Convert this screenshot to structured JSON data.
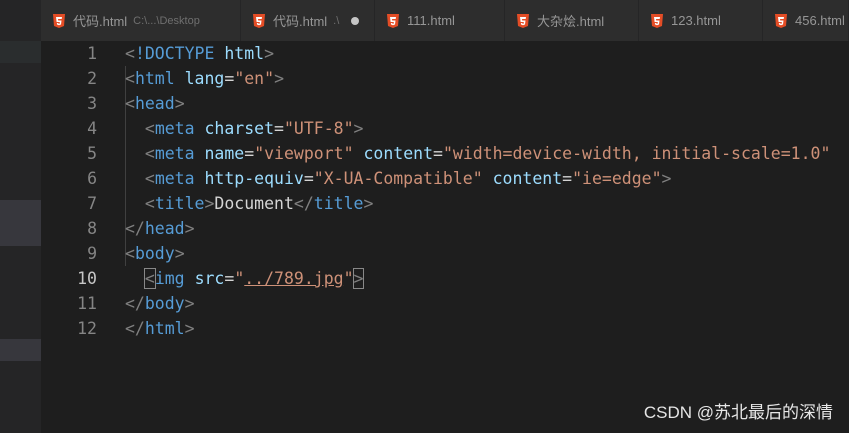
{
  "tabs": [
    {
      "name": "代码.html",
      "desc": "C:\\...\\Desktop",
      "dirty": false
    },
    {
      "name": "代码.html",
      "desc": ".\\",
      "dirty": true
    },
    {
      "name": "111.html",
      "desc": "",
      "dirty": false
    },
    {
      "name": "大杂烩.html",
      "desc": "",
      "dirty": false
    },
    {
      "name": "123.html",
      "desc": "",
      "dirty": false
    },
    {
      "name": "456.html",
      "desc": "",
      "dirty": false
    }
  ],
  "editor": {
    "active_line": 10,
    "line_numbers": [
      "1",
      "2",
      "3",
      "4",
      "5",
      "6",
      "7",
      "8",
      "9",
      "10",
      "11",
      "12"
    ],
    "lines": [
      {
        "tokens": [
          {
            "c": "br",
            "t": "<"
          },
          {
            "c": "tg",
            "t": "!DOCTYPE"
          },
          {
            "c": "tx",
            "t": " "
          },
          {
            "c": "at",
            "t": "html"
          },
          {
            "c": "br",
            "t": ">"
          }
        ]
      },
      {
        "tokens": [
          {
            "c": "br",
            "t": "<"
          },
          {
            "c": "tg",
            "t": "html"
          },
          {
            "c": "tx",
            "t": " "
          },
          {
            "c": "at",
            "t": "lang"
          },
          {
            "c": "tx",
            "t": "="
          },
          {
            "c": "st",
            "t": "\"en\""
          },
          {
            "c": "br",
            "t": ">"
          }
        ]
      },
      {
        "tokens": [
          {
            "c": "br",
            "t": "<"
          },
          {
            "c": "tg",
            "t": "head"
          },
          {
            "c": "br",
            "t": ">"
          }
        ]
      },
      {
        "tokens": [
          {
            "c": "tx",
            "t": "  "
          },
          {
            "c": "br",
            "t": "<"
          },
          {
            "c": "tg",
            "t": "meta"
          },
          {
            "c": "tx",
            "t": " "
          },
          {
            "c": "at",
            "t": "charset"
          },
          {
            "c": "tx",
            "t": "="
          },
          {
            "c": "st",
            "t": "\"UTF-8\""
          },
          {
            "c": "br",
            "t": ">"
          }
        ]
      },
      {
        "tokens": [
          {
            "c": "tx",
            "t": "  "
          },
          {
            "c": "br",
            "t": "<"
          },
          {
            "c": "tg",
            "t": "meta"
          },
          {
            "c": "tx",
            "t": " "
          },
          {
            "c": "at",
            "t": "name"
          },
          {
            "c": "tx",
            "t": "="
          },
          {
            "c": "st",
            "t": "\"viewport\""
          },
          {
            "c": "tx",
            "t": " "
          },
          {
            "c": "at",
            "t": "content"
          },
          {
            "c": "tx",
            "t": "="
          },
          {
            "c": "st",
            "t": "\"width=device-width, initial-scale=1.0\""
          }
        ]
      },
      {
        "tokens": [
          {
            "c": "tx",
            "t": "  "
          },
          {
            "c": "br",
            "t": "<"
          },
          {
            "c": "tg",
            "t": "meta"
          },
          {
            "c": "tx",
            "t": " "
          },
          {
            "c": "at",
            "t": "http-equiv"
          },
          {
            "c": "tx",
            "t": "="
          },
          {
            "c": "st",
            "t": "\"X-UA-Compatible\""
          },
          {
            "c": "tx",
            "t": " "
          },
          {
            "c": "at",
            "t": "content"
          },
          {
            "c": "tx",
            "t": "="
          },
          {
            "c": "st",
            "t": "\"ie=edge\""
          },
          {
            "c": "br",
            "t": ">"
          }
        ]
      },
      {
        "tokens": [
          {
            "c": "tx",
            "t": "  "
          },
          {
            "c": "br",
            "t": "<"
          },
          {
            "c": "tg",
            "t": "title"
          },
          {
            "c": "br",
            "t": ">"
          },
          {
            "c": "tx",
            "t": "Document"
          },
          {
            "c": "br",
            "t": "</"
          },
          {
            "c": "tg",
            "t": "title"
          },
          {
            "c": "br",
            "t": ">"
          }
        ]
      },
      {
        "tokens": [
          {
            "c": "br",
            "t": "</"
          },
          {
            "c": "tg",
            "t": "head"
          },
          {
            "c": "br",
            "t": ">"
          }
        ]
      },
      {
        "tokens": [
          {
            "c": "br",
            "t": "<"
          },
          {
            "c": "tg",
            "t": "body"
          },
          {
            "c": "br",
            "t": ">"
          }
        ]
      },
      {
        "tokens": [
          {
            "c": "tx",
            "t": "  "
          },
          {
            "c": "br match",
            "t": "<"
          },
          {
            "c": "tg",
            "t": "img"
          },
          {
            "c": "tx",
            "t": " "
          },
          {
            "c": "at",
            "t": "src"
          },
          {
            "c": "tx",
            "t": "="
          },
          {
            "c": "st",
            "t": "\""
          },
          {
            "c": "st lk",
            "t": "../789.jpg"
          },
          {
            "c": "st",
            "t": "\""
          },
          {
            "c": "br match",
            "t": ">"
          }
        ]
      },
      {
        "tokens": [
          {
            "c": "br",
            "t": "</"
          },
          {
            "c": "tg",
            "t": "body"
          },
          {
            "c": "br",
            "t": ">"
          }
        ]
      },
      {
        "tokens": [
          {
            "c": "br",
            "t": "</"
          },
          {
            "c": "tg",
            "t": "html"
          },
          {
            "c": "br",
            "t": ">"
          }
        ]
      }
    ]
  },
  "watermark": "CSDN @苏北最后的深情",
  "colors": {
    "background": "#1e1e1e",
    "tab_bg": "#2d2d2d",
    "html5_icon": "#e44d26",
    "tag": "#569cd6",
    "attribute": "#9cdcfe",
    "string": "#ce9178",
    "bracket": "#808080"
  },
  "icons": {
    "tab_icon": "html5-icon"
  }
}
